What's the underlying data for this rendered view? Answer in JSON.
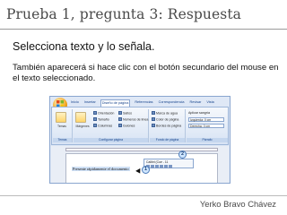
{
  "slide": {
    "title": "Prueba 1, pregunta 3: Respuesta",
    "heading": "Selecciona texto y lo señala.",
    "body": "También aparecerá si hace clic con el botón secundario del mouse en el texto seleccionado.",
    "author": "Yerko Bravo Chávez"
  },
  "screenshot": {
    "tabs": [
      {
        "label": "Inicio",
        "active": false
      },
      {
        "label": "Insertar",
        "active": false
      },
      {
        "label": "Diseño de página",
        "active": true
      },
      {
        "label": "Referencias",
        "active": false
      },
      {
        "label": "Correspondencia",
        "active": false
      },
      {
        "label": "Revisar",
        "active": false
      },
      {
        "label": "Vista",
        "active": false
      }
    ],
    "groups": {
      "temas": "Temas",
      "configurar_pagina": "Configurar página",
      "fondo_pagina": "Fondo de página",
      "parrafo": "Párrafo"
    },
    "buttons": {
      "temas": "Temas",
      "margenes": "Márgenes",
      "orientacion": "Orientación",
      "tamano": "Tamaño",
      "columnas": "Columnas",
      "saltos": "Saltos",
      "numeros_linea": "Números de línea",
      "guiones": "Guiones",
      "marca_agua": "Marca de agua",
      "color_pagina": "Color de página",
      "bordes_pagina": "Bordes de página",
      "aplicar_sangria": "Aplicar sangría",
      "izquierda": "Izquierda: 0 cm",
      "derecha": "Derecha: 0 cm"
    },
    "mini_toolbar_font": "Calibri (Cue - 11",
    "doc_text": "Presente rápidamente el documento",
    "callouts": [
      "1",
      "2"
    ]
  }
}
